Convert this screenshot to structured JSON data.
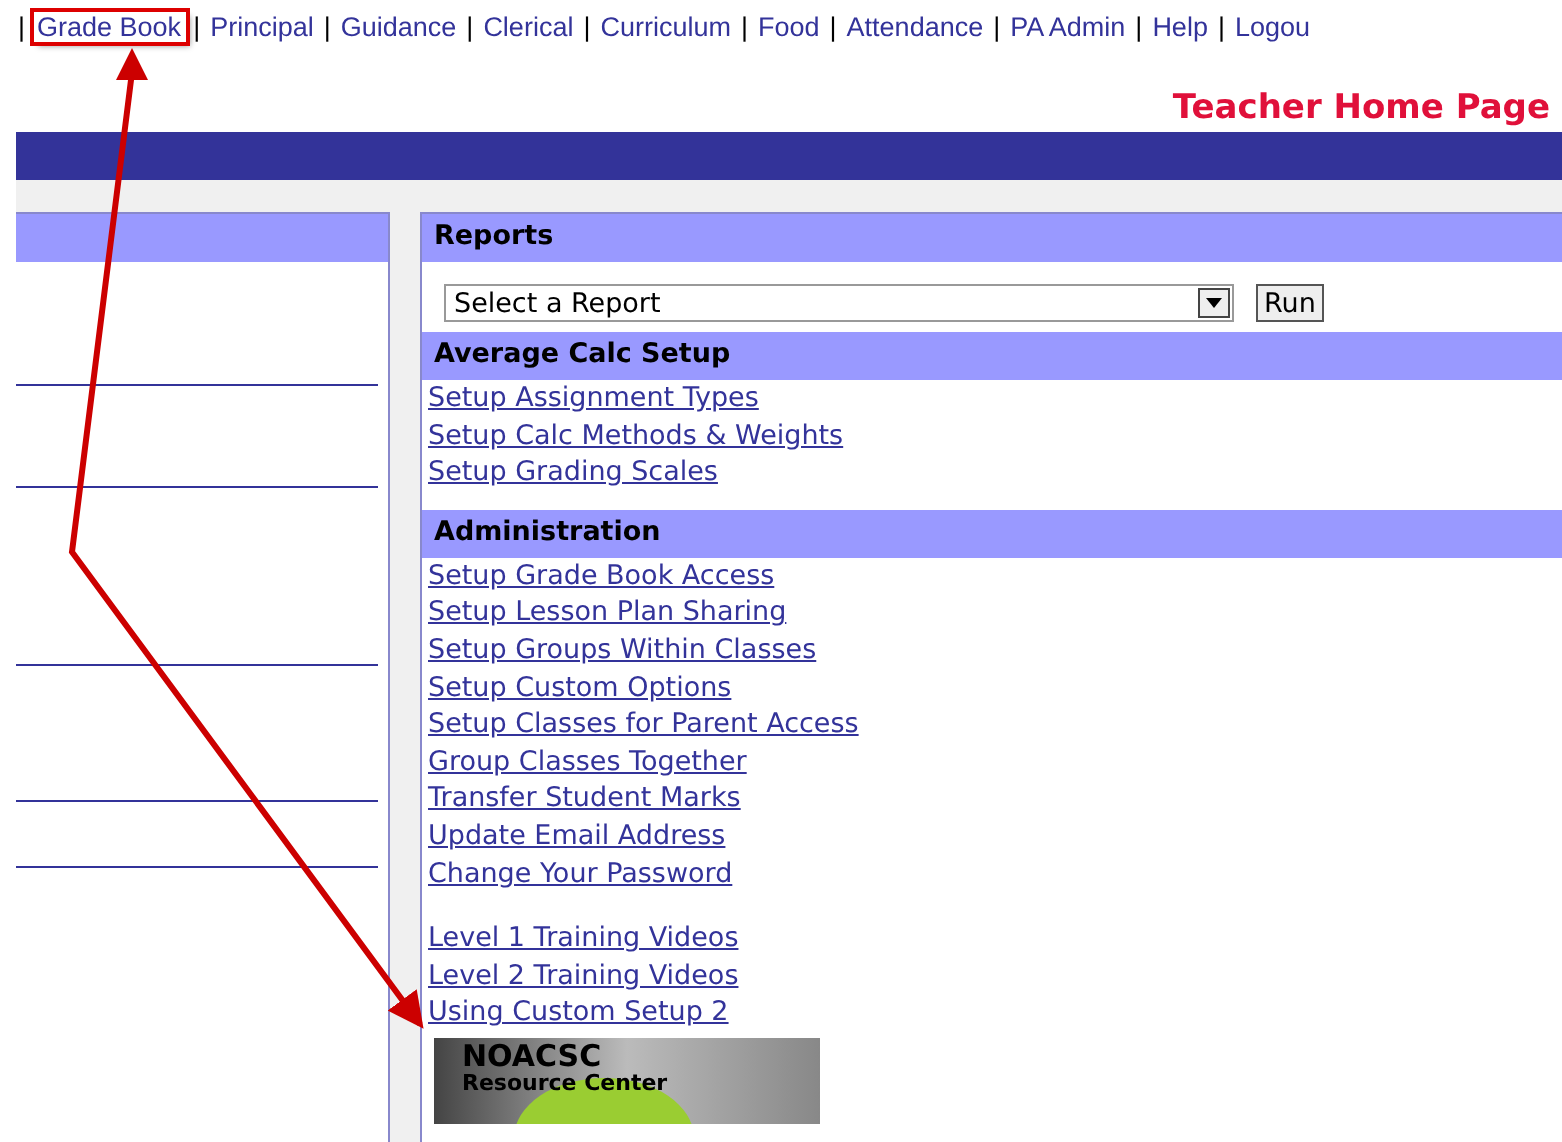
{
  "nav": [
    {
      "label": "Grade Book",
      "highlighted": true
    },
    {
      "label": "Principal",
      "highlighted": false
    },
    {
      "label": "Guidance",
      "highlighted": false
    },
    {
      "label": "Clerical",
      "highlighted": false
    },
    {
      "label": "Curriculum",
      "highlighted": false
    },
    {
      "label": "Food",
      "highlighted": false
    },
    {
      "label": "Attendance",
      "highlighted": false
    },
    {
      "label": "PA Admin",
      "highlighted": false
    },
    {
      "label": "Help",
      "highlighted": false
    },
    {
      "label": "Logou",
      "highlighted": false
    }
  ],
  "separator": "|",
  "page_title": "Teacher Home Page",
  "reports": {
    "title": "Reports",
    "select": {
      "value": "Select a Report"
    },
    "run_button": "Run"
  },
  "sections": [
    {
      "title": "Average Calc Setup",
      "links": [
        "Setup Assignment Types",
        "Setup Calc Methods & Weights",
        "Setup Grading Scales"
      ]
    },
    {
      "title": "Administration",
      "links": [
        "Setup Grade Book Access",
        "Setup Lesson Plan Sharing",
        "Setup Groups Within Classes",
        "Setup Custom Options",
        "Setup Classes for Parent Access",
        "Group Classes Together",
        "Transfer Student Marks",
        "Update Email Address",
        "Change Your Password"
      ]
    }
  ],
  "training_links": [
    "Level 1 Training Videos",
    "Level 2 Training Videos",
    "Using Custom Setup 2"
  ],
  "banner": {
    "title": "NOACSC",
    "subtitle": "Resource Center"
  }
}
